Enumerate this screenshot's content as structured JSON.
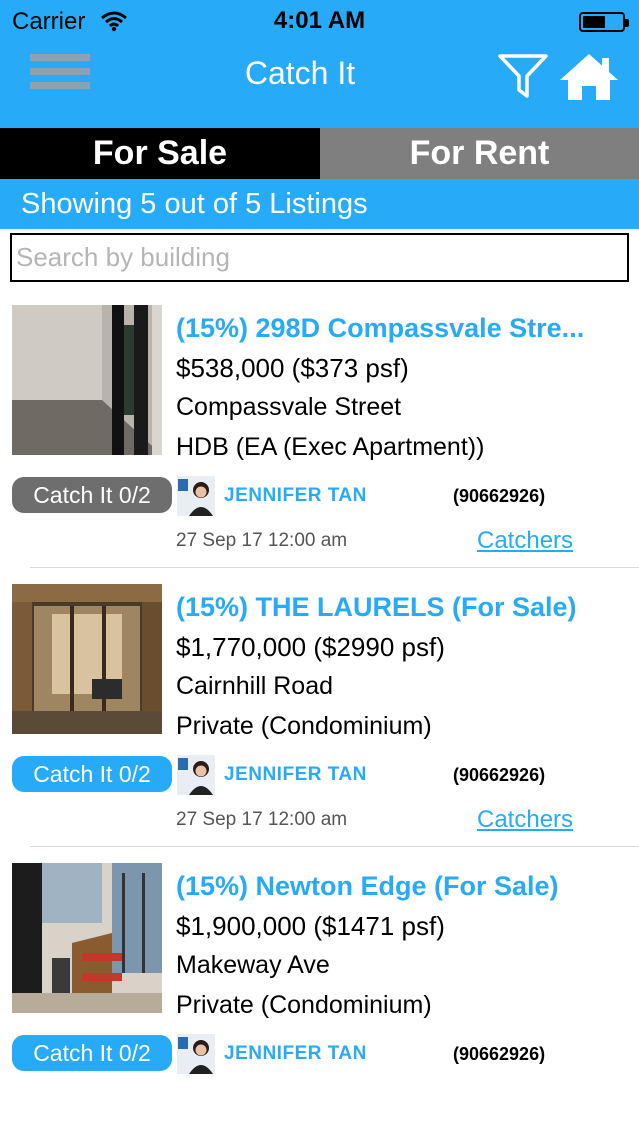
{
  "status_bar": {
    "carrier": "Carrier",
    "time": "4:01 AM"
  },
  "header": {
    "title": "Catch It",
    "background": "#27aaf7"
  },
  "tabs": [
    {
      "label": "For Sale",
      "active": true
    },
    {
      "label": "For Rent",
      "active": false
    }
  ],
  "count_text": "Showing 5 out of 5 Listings",
  "search": {
    "placeholder": "Search by building",
    "value": ""
  },
  "listings": [
    {
      "title": "(15%) 298D Compassvale Stre...",
      "price": "$538,000 ($373 psf)",
      "street": "Compassvale Street",
      "type": "HDB (EA (Exec Apartment))",
      "catch_label": "Catch It 0/2",
      "catch_color": "#6e6e6e",
      "agent_name": "JENNIFER TAN",
      "agent_phone": "(90662926)",
      "date": "27 Sep 17 12:00 am",
      "catchers_label": "Catchers"
    },
    {
      "title": "(15%) THE LAURELS (For Sale)",
      "price": "$1,770,000 ($2990 psf)",
      "street": "Cairnhill Road",
      "type": "Private (Condominium)",
      "catch_label": "Catch It 0/2",
      "catch_color": "#27aaf7",
      "agent_name": "JENNIFER TAN",
      "agent_phone": "(90662926)",
      "date": "27 Sep 17 12:00 am",
      "catchers_label": "Catchers"
    },
    {
      "title": "(15%) Newton Edge (For Sale)",
      "price": "$1,900,000 ($1471 psf)",
      "street": "Makeway Ave",
      "type": "Private (Condominium)",
      "catch_label": "Catch It 0/2",
      "catch_color": "#27aaf7",
      "agent_name": "JENNIFER TAN",
      "agent_phone": "(90662926)"
    }
  ]
}
